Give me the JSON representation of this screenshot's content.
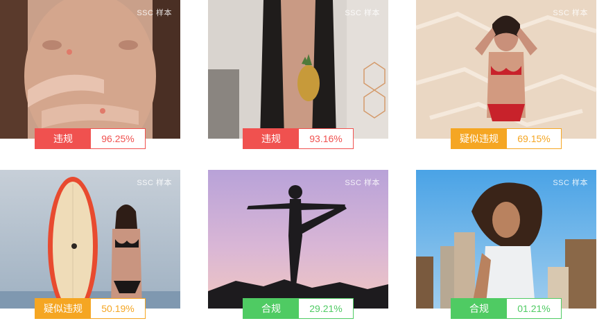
{
  "watermark": "SSC 样本",
  "colors": {
    "violation": "#f0514f",
    "suspected": "#f5a623",
    "compliant": "#4fcb63"
  },
  "cards": [
    {
      "label": "违规",
      "score": "96.25%",
      "status": "violation"
    },
    {
      "label": "违规",
      "score": "93.16%",
      "status": "violation"
    },
    {
      "label": "疑似违规",
      "score": "69.15%",
      "status": "suspected"
    },
    {
      "label": "疑似违规",
      "score": "50.19%",
      "status": "suspected"
    },
    {
      "label": "合规",
      "score": "29.21%",
      "status": "compliant"
    },
    {
      "label": "合规",
      "score": "01.21%",
      "status": "compliant"
    }
  ]
}
